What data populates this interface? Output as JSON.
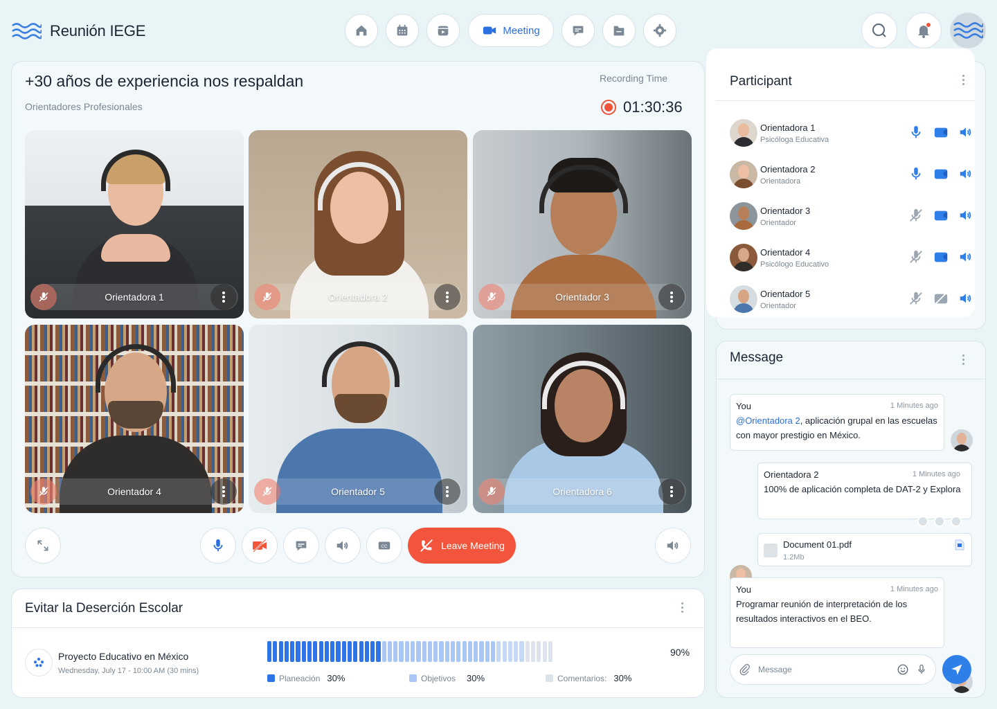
{
  "brand": {
    "name": "Reunión IEGE"
  },
  "nav": {
    "items": [
      {
        "icon": "home-icon"
      },
      {
        "icon": "calendar-icon"
      },
      {
        "icon": "video-calendar-icon"
      },
      {
        "icon": "video-camera-icon",
        "label": "Meeting"
      },
      {
        "icon": "chat-icon"
      },
      {
        "icon": "folder-icon"
      },
      {
        "icon": "gear-icon"
      }
    ]
  },
  "meeting": {
    "title": "+30 años de experiencia nos respaldan",
    "subtitle": "Orientadores Profesionales",
    "recording_label": "Recording Time",
    "recording_time": "01:30:36",
    "tiles": [
      {
        "name": "Orientadora 1"
      },
      {
        "name": "Orientadora 2"
      },
      {
        "name": "Orientador 3"
      },
      {
        "name": "Orientador 4"
      },
      {
        "name": "Orientador 5"
      },
      {
        "name": "Orientadora 6"
      }
    ],
    "leave_label": "Leave Meeting"
  },
  "project": {
    "title": "Evitar la Deserción Escolar",
    "name": "Proyecto Educativo en México",
    "date": "Wednesday, July 17 - 10:00 AM (30 mins)",
    "progress_percent": 90,
    "progress_label": "90%",
    "legend": [
      {
        "label": "Planeación",
        "value": "30%",
        "color": "#2f74e6"
      },
      {
        "label": "Objetivos",
        "value": "30%",
        "color": "#a9c6f4"
      },
      {
        "label": "Comentarios:",
        "value": "30%",
        "color": "#dde3ea"
      }
    ]
  },
  "participants": {
    "title": "Participant",
    "list": [
      {
        "name": "Orientadora 1",
        "role": "Psicóloga Educativa",
        "mic": "on",
        "video": "on"
      },
      {
        "name": "Orientadora 2",
        "role": "Orientadora",
        "mic": "on",
        "video": "on"
      },
      {
        "name": "Orientador 3",
        "role": "Orientador",
        "mic": "off",
        "video": "on"
      },
      {
        "name": "Orientador 4",
        "role": "Psicólogo Educativo",
        "mic": "off",
        "video": "on"
      },
      {
        "name": "Orientador 5",
        "role": "Orientador",
        "mic": "off",
        "video": "off"
      }
    ]
  },
  "messages": {
    "title": "Message",
    "items": [
      {
        "author": "You",
        "time": "1 Minutes ago",
        "mention": "@Orientadora 2",
        "text": ", aplicación grupal en las escuelas con mayor prestigio en México."
      },
      {
        "author": "Orientadora 2",
        "time": "1 Minutes ago",
        "text": "100% de aplicación completa de DAT-2 y Explora"
      },
      {
        "file_name": "Document 01.pdf",
        "file_size": "1.2Mb"
      },
      {
        "author": "You",
        "time": "1 Minutes ago",
        "text": "Programar reunión de interpretación de los resultados interactivos en el BEO."
      }
    ],
    "input_placeholder": "Message"
  },
  "colors": {
    "accent": "#2b6fe0",
    "danger": "#f2553c",
    "background": "#e9f4f6"
  }
}
